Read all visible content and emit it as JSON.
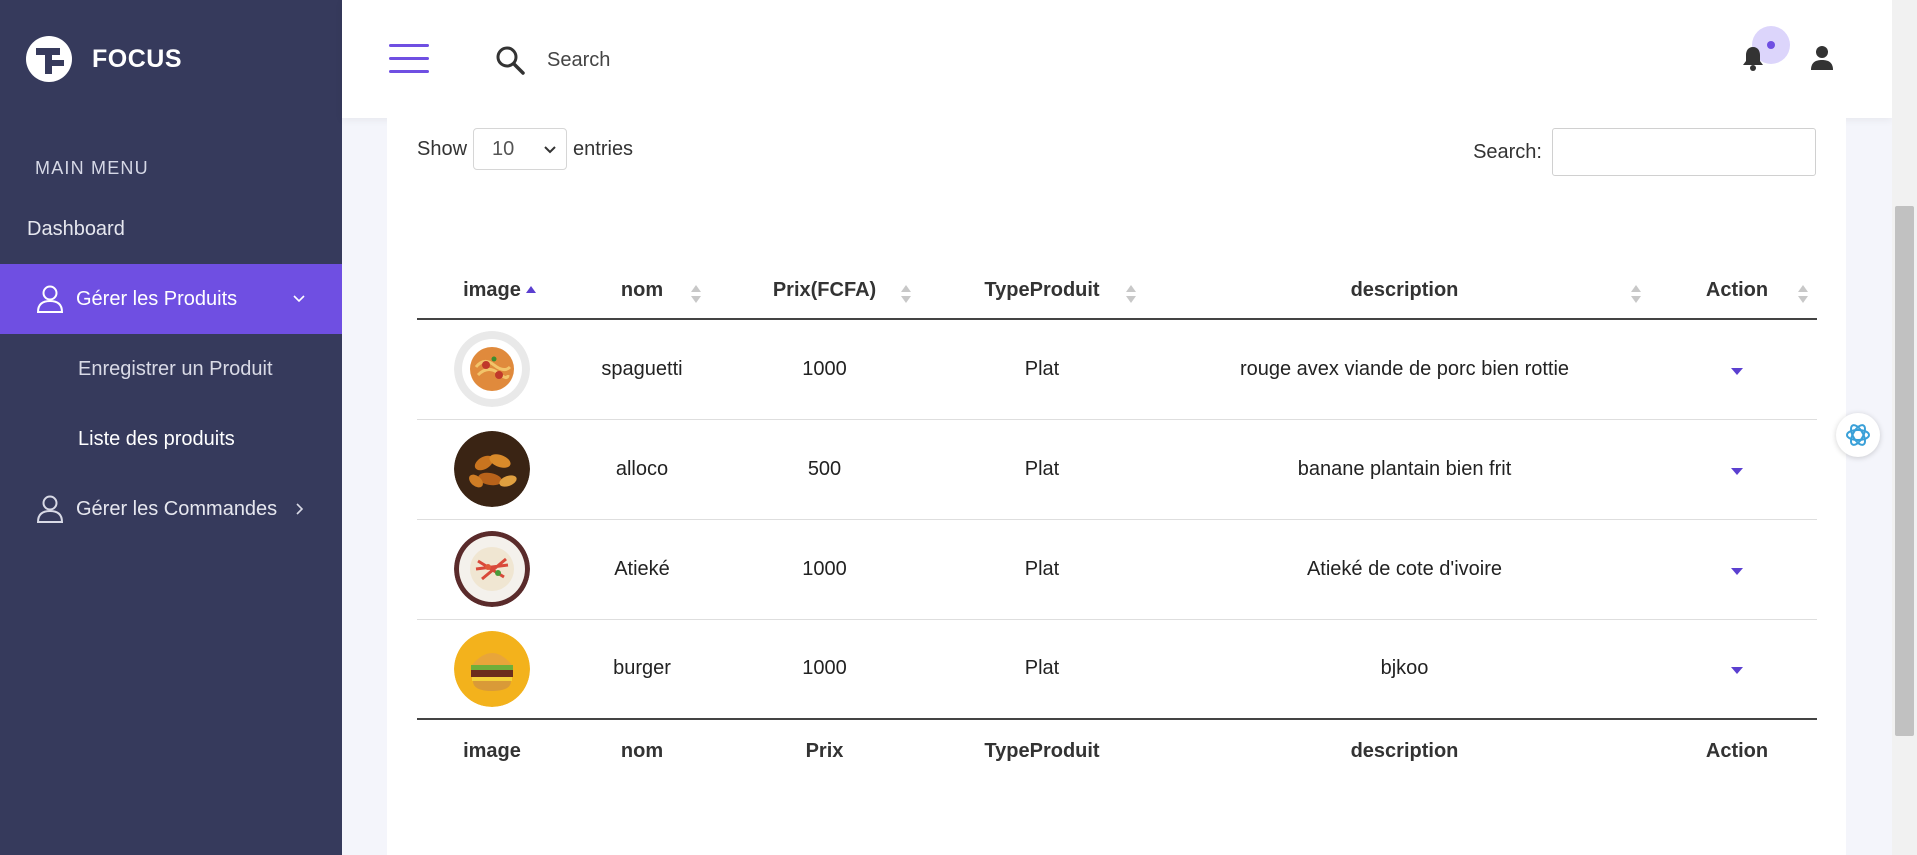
{
  "brand": {
    "name": "FOCUS"
  },
  "sidebar": {
    "menu_title": "MAIN MENU",
    "items": [
      {
        "label": "Dashboard"
      },
      {
        "label": "Gérer les Produits",
        "expanded": true
      },
      {
        "label": "Enregistrer un Produit"
      },
      {
        "label": "Liste des produits",
        "current": true
      },
      {
        "label": "Gérer les Commandes"
      }
    ]
  },
  "header": {
    "search_placeholder": "Search"
  },
  "table_controls": {
    "show_label": "Show",
    "page_length": "10",
    "entries_label": "entries",
    "search_label": "Search:"
  },
  "table": {
    "columns": [
      "image",
      "nom",
      "Prix(FCFA)",
      "TypeProduit",
      "description",
      "Action"
    ],
    "footer_columns": [
      "image",
      "nom",
      "Prix",
      "TypeProduit",
      "description",
      "Action"
    ],
    "rows": [
      {
        "image": "spaghetti-photo",
        "nom": "spaguetti",
        "prix": "1000",
        "type": "Plat",
        "description": "rouge avex viande de porc bien rottie"
      },
      {
        "image": "alloco-photo",
        "nom": "alloco",
        "prix": "500",
        "type": "Plat",
        "description": "banane plantain bien frit"
      },
      {
        "image": "atieke-photo",
        "nom": "Atieké",
        "prix": "1000",
        "type": "Plat",
        "description": "Atieké de cote d'ivoire"
      },
      {
        "image": "burger-photo",
        "nom": "burger",
        "prix": "1000",
        "type": "Plat",
        "description": "bjkoo"
      }
    ]
  },
  "colors": {
    "accent": "#6f4fe2",
    "sidebar": "#363a5c"
  }
}
